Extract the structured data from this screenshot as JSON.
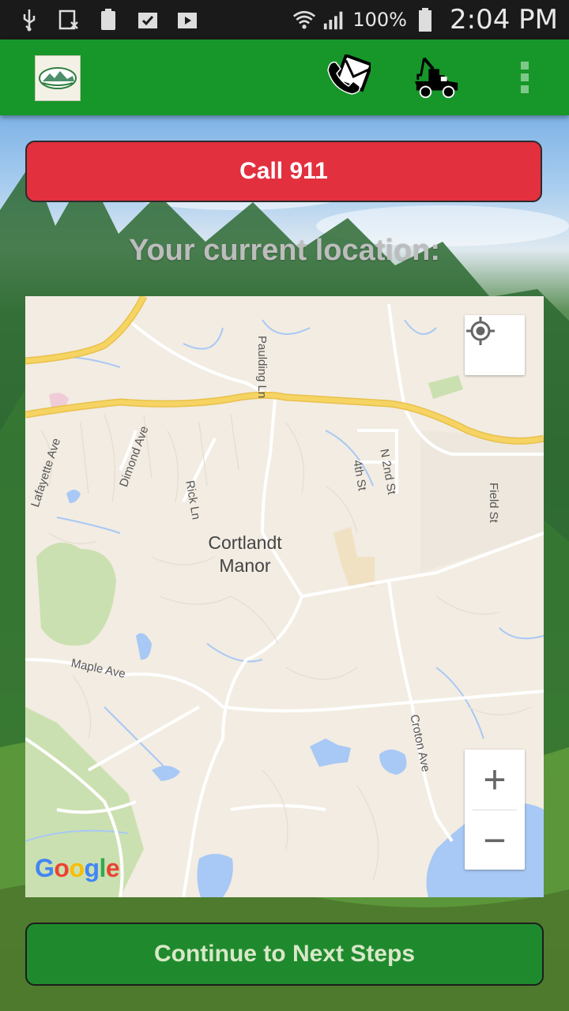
{
  "status_bar": {
    "battery": "100%",
    "time": "2:04 PM",
    "icons": [
      "usb-icon",
      "sim-blocked-icon",
      "battery-saver-icon",
      "task-check-icon",
      "media-upload-icon",
      "wifi-icon",
      "signal-icon",
      "battery-icon"
    ]
  },
  "app_bar": {
    "icons": [
      "logo-icon",
      "phone-call-icon",
      "tow-truck-icon",
      "overflow-menu-icon"
    ]
  },
  "emergency": {
    "call_label": "Call 911"
  },
  "location": {
    "title": "Your current location:"
  },
  "map": {
    "town_line1": "Cortlandt",
    "town_line2": "Manor",
    "streets": {
      "paulding": "Paulding Ln",
      "lafayette": "Lafayette Ave",
      "dimond": "Dimond Ave",
      "rick": "Rick Ln",
      "fourth": "4th St",
      "n2nd": "N 2nd St",
      "field": "Field St",
      "maple": "Maple Ave",
      "croton": "Croton Ave"
    },
    "zoom_in": "+",
    "zoom_out": "−",
    "attribution": "Google",
    "colors": {
      "land": "#f2ece2",
      "highway": "#f6d463",
      "water": "#a8c8f5",
      "park": "#cbe0b0"
    }
  },
  "footer": {
    "continue_label": "Continue to Next Steps"
  }
}
